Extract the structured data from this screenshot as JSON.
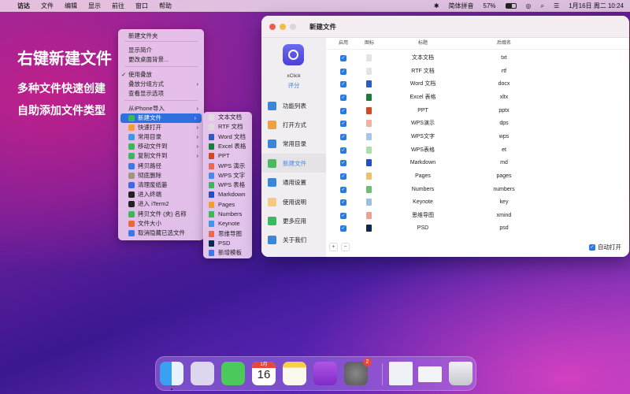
{
  "menubar": {
    "apple": "",
    "items": [
      "访达",
      "文件",
      "编辑",
      "显示",
      "前往",
      "窗口",
      "帮助"
    ],
    "input_method": "简体拼音",
    "battery": "57%",
    "datetime": "1月16日 周二  10:24"
  },
  "hero": {
    "title": "右键新建文件",
    "line1": "多种文件快速创建",
    "line2": "自助添加文件类型"
  },
  "context_menu": {
    "items": [
      "新建文件夹",
      "显示简介",
      "更改桌面背景...",
      "使用叠放",
      "叠放分组方式",
      "查看显示选项",
      "从iPhone导入",
      "新建文件",
      "快速打开",
      "常用目录",
      "移动文件到",
      "复制文件到",
      "拷贝路径",
      "彻底删除",
      "清理废纸篓",
      "进入终端",
      "进入 iTerm2",
      "拷贝文件 (夹) 名称",
      "文件大小",
      "取消隐藏已选文件"
    ],
    "check": "✓",
    "chevron": "›"
  },
  "submenu": {
    "items": [
      "文本文档",
      "RTF 文档",
      "Word 文档",
      "Excel 表格",
      "PPT",
      "WPS 演示",
      "WPS 文字",
      "WPS 表格",
      "Markdown",
      "Pages",
      "Numbers",
      "Keynote",
      "思维导图",
      "PSD",
      "新增模板"
    ]
  },
  "window": {
    "title": "新建文件",
    "app_name": "xClick",
    "rate": "评分",
    "nav": [
      "功能列表",
      "打开方式",
      "常用目录",
      "新建文件",
      "通用设置",
      "使用说明",
      "更多应用",
      "关于我们"
    ],
    "headers": [
      "启用",
      "图标",
      "标题",
      "后缀名"
    ],
    "rows": [
      [
        "文本文档",
        "txt"
      ],
      [
        "RTF 文档",
        "rtf"
      ],
      [
        "Word 文档",
        "docx"
      ],
      [
        "Excel 表格",
        "xltx"
      ],
      [
        "PPT",
        "pptx"
      ],
      [
        "WPS演示",
        "dps"
      ],
      [
        "WPS文字",
        "wps"
      ],
      [
        "WPS表格",
        "et"
      ],
      [
        "Markdown",
        "md"
      ],
      [
        "Pages",
        "pages"
      ],
      [
        "Numbers",
        "numbers"
      ],
      [
        "Keynote",
        "key"
      ],
      [
        "思维导图",
        "xmind"
      ],
      [
        "PSD",
        "psd"
      ]
    ],
    "add": "+",
    "remove": "−",
    "auto_open": "自动打开",
    "check": "✓"
  },
  "dock": {
    "calendar_month": "1月",
    "calendar_day": "16",
    "settings_badge": "2"
  }
}
